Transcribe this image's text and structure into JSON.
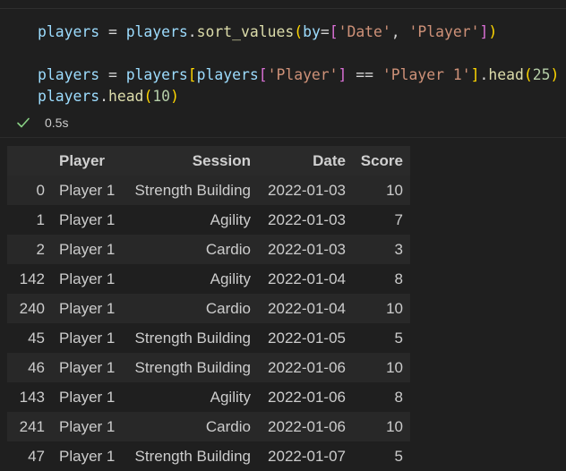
{
  "code": {
    "line1": {
      "var": "players",
      "eq": " = ",
      "obj": "players",
      "dot": ".",
      "method": "sort_values",
      "open": "(",
      "kw": "by",
      "assign": "=",
      "lbr": "[",
      "str1": "'Date'",
      "comma": ", ",
      "str2": "'Player'",
      "rbr": "]",
      "close": ")"
    },
    "line2": {
      "var": "players",
      "eq": " = ",
      "obj": "players",
      "lbr": "[",
      "inner": "players",
      "ilbr": "[",
      "str": "'Player'",
      "irbr": "]",
      "cmp": " == ",
      "str2": "'Player 1'",
      "rbr": "]",
      "dot": ".",
      "method": "head",
      "open": "(",
      "num": "25",
      "close": ")"
    },
    "line3": {
      "obj": "players",
      "dot": ".",
      "method": "head",
      "open": "(",
      "num": "10",
      "close": ")"
    }
  },
  "status": {
    "icon": "check-icon",
    "time": "0.5s",
    "color": "#89d185"
  },
  "table": {
    "columns": [
      "",
      "Player",
      "Session",
      "Date",
      "Score"
    ],
    "rows": [
      [
        "0",
        "Player 1",
        "Strength Building",
        "2022-01-03",
        "10"
      ],
      [
        "1",
        "Player 1",
        "Agility",
        "2022-01-03",
        "7"
      ],
      [
        "2",
        "Player 1",
        "Cardio",
        "2022-01-03",
        "3"
      ],
      [
        "142",
        "Player 1",
        "Agility",
        "2022-01-04",
        "8"
      ],
      [
        "240",
        "Player 1",
        "Cardio",
        "2022-01-04",
        "10"
      ],
      [
        "45",
        "Player 1",
        "Strength Building",
        "2022-01-05",
        "5"
      ],
      [
        "46",
        "Player 1",
        "Strength Building",
        "2022-01-06",
        "10"
      ],
      [
        "143",
        "Player 1",
        "Agility",
        "2022-01-06",
        "8"
      ],
      [
        "241",
        "Player 1",
        "Cardio",
        "2022-01-06",
        "10"
      ],
      [
        "47",
        "Player 1",
        "Strength Building",
        "2022-01-07",
        "5"
      ]
    ]
  }
}
